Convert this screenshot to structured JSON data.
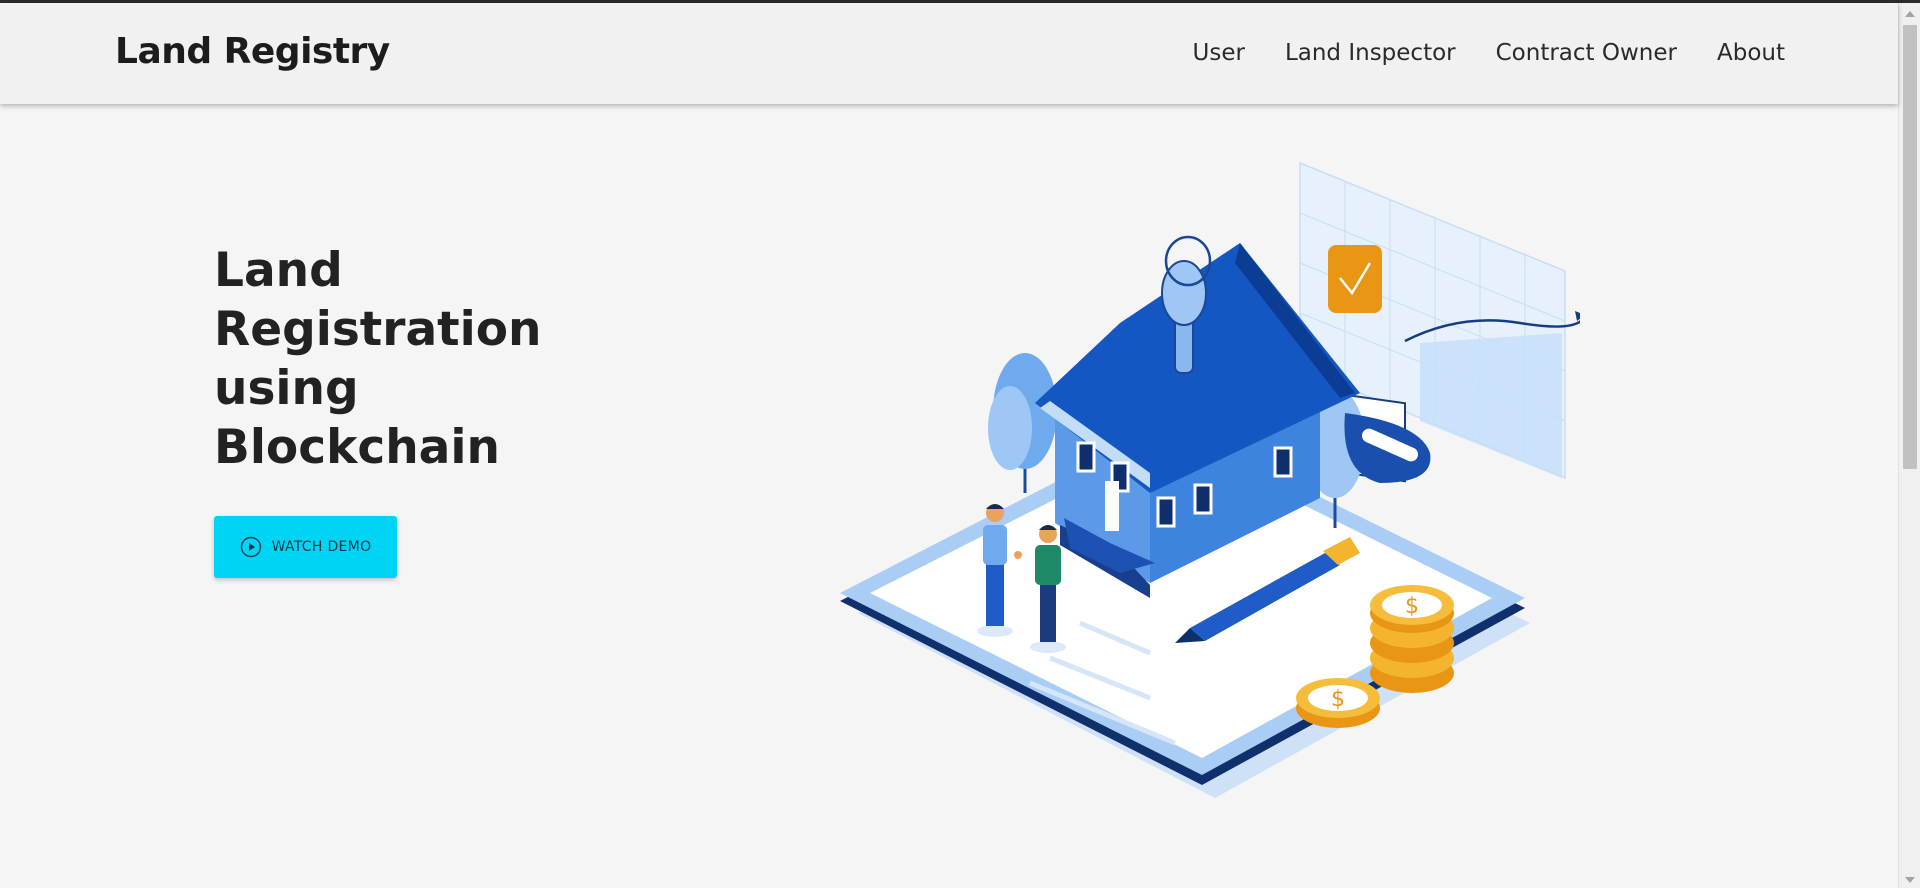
{
  "navbar": {
    "brand": "Land Registry",
    "links": [
      {
        "label": "User"
      },
      {
        "label": "Land Inspector"
      },
      {
        "label": "Contract Owner"
      },
      {
        "label": "About"
      }
    ]
  },
  "hero": {
    "title_lines": [
      "Land",
      "Registration",
      "using",
      "Blockchain"
    ],
    "button_label": "WATCH DEMO",
    "button_icon": "play-circle-icon",
    "illustration": "isometric-house-blockchain-illustration"
  },
  "colors": {
    "accent": "#00d4f5",
    "navbar_bg": "#f1f1f1",
    "page_bg": "#f5f5f5",
    "house_blue": "#1e5fbf",
    "coin_gold": "#f3b52e"
  }
}
